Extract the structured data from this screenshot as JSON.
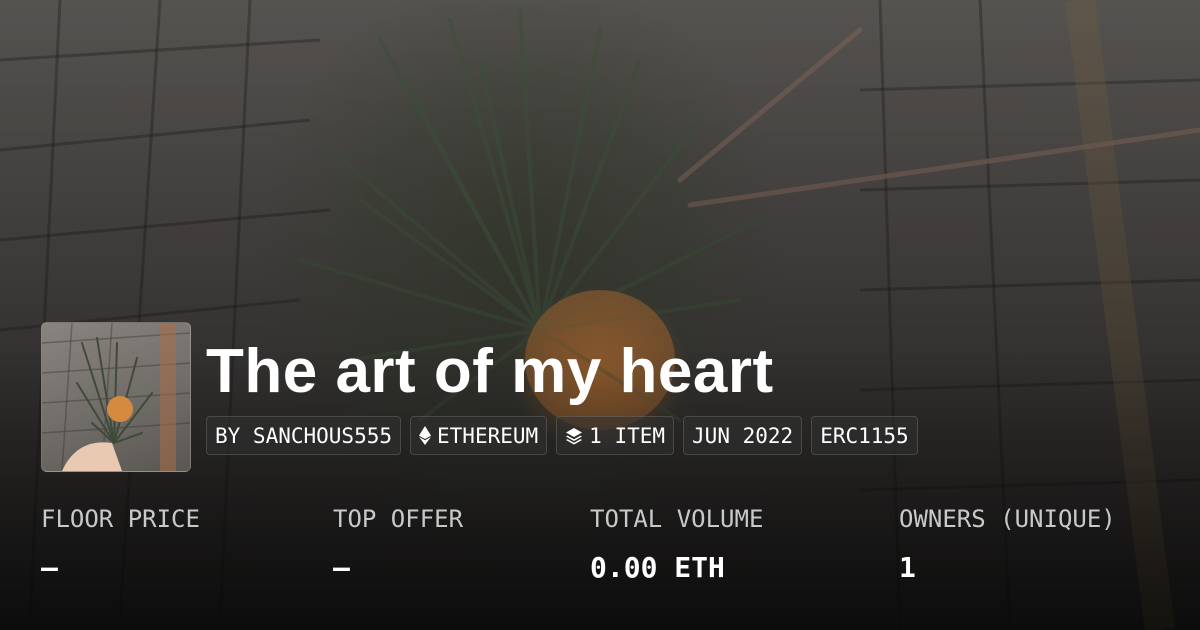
{
  "collection": {
    "title": "The art of my heart"
  },
  "chips": {
    "creator": "BY SANCHOUS555",
    "chain": "ETHEREUM",
    "items": "1 ITEM",
    "date": "JUN 2022",
    "standard": "ERC1155"
  },
  "icons": {
    "chain": "ethereum-icon",
    "items": "stack-layers-icon"
  },
  "stats": {
    "floor_price": {
      "label": "FLOOR PRICE",
      "value": "—"
    },
    "top_offer": {
      "label": "TOP OFFER",
      "value": "—"
    },
    "total_volume": {
      "label": "TOTAL VOLUME",
      "value": "0.00 ETH"
    },
    "owners": {
      "label": "OWNERS (UNIQUE)",
      "value": "1"
    }
  }
}
